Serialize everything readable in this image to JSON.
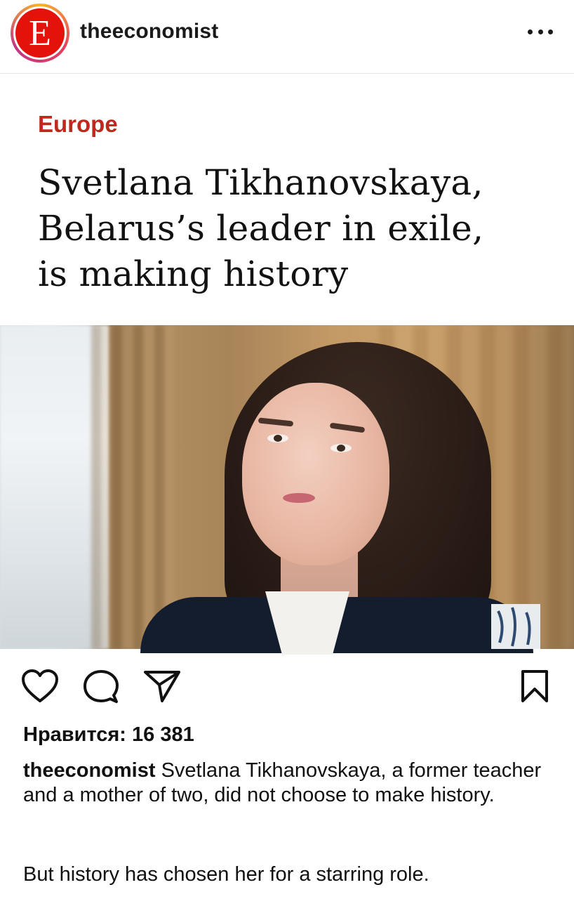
{
  "header": {
    "avatar_letter": "E",
    "username": "theeconomist",
    "more_icon": "more-horizontal-icon"
  },
  "post_image": {
    "section": "Europe",
    "headline_lines": [
      "Svetlana Tikhanovskaya,",
      "Belarus’s leader in exile,",
      "is making history"
    ]
  },
  "actions": {
    "like_icon": "heart-icon",
    "comment_icon": "comment-icon",
    "share_icon": "paper-plane-icon",
    "save_icon": "bookmark-icon"
  },
  "likes_text": "Нравится: 16 381",
  "caption": {
    "username": "theeconomist",
    "text": " Svetlana Tikhanovskaya, a former teacher and a mother of two, did not choose to make history.",
    "second_paragraph": "But history has chosen her for a starring role."
  },
  "colors": {
    "brand_red": "#e3120b",
    "section_red": "#c0281e",
    "text": "#111111"
  }
}
